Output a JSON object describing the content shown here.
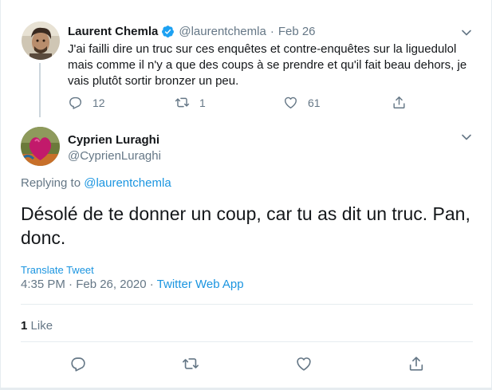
{
  "parent_tweet": {
    "author_name": "Laurent Chemla",
    "handle": "@laurentchemla",
    "separator": "·",
    "date": "Feb 26",
    "verified": true,
    "text": "J'ai failli dire un truc sur ces enquêtes et contre-enquêtes sur la liguedulol mais comme il n'y a que des coups à se prendre et qu'il fait beau dehors, je vais plutôt sortir bronzer un peu.",
    "replies": "12",
    "retweets": "1",
    "likes": "61"
  },
  "main_tweet": {
    "author_name": "Cyprien Luraghi",
    "handle": "@CyprienLuraghi",
    "replying_prefix": "Replying to ",
    "replying_to": "@laurentchemla",
    "text": "Désolé de te donner un coup, car tu as dit un truc. Pan, donc.",
    "translate_label": "Translate Tweet",
    "timestamp": "4:35 PM · Feb 26, 2020",
    "meta_separator": " · ",
    "source": "Twitter Web App",
    "like_count": "1",
    "like_label": "Like"
  },
  "colors": {
    "accent": "#1b95e0",
    "secondary_text": "#657786",
    "verified": "#1da1f2"
  },
  "icons": [
    "reply-icon",
    "retweet-icon",
    "like-icon",
    "share-icon",
    "chevron-down-icon",
    "verified-badge-icon"
  ]
}
